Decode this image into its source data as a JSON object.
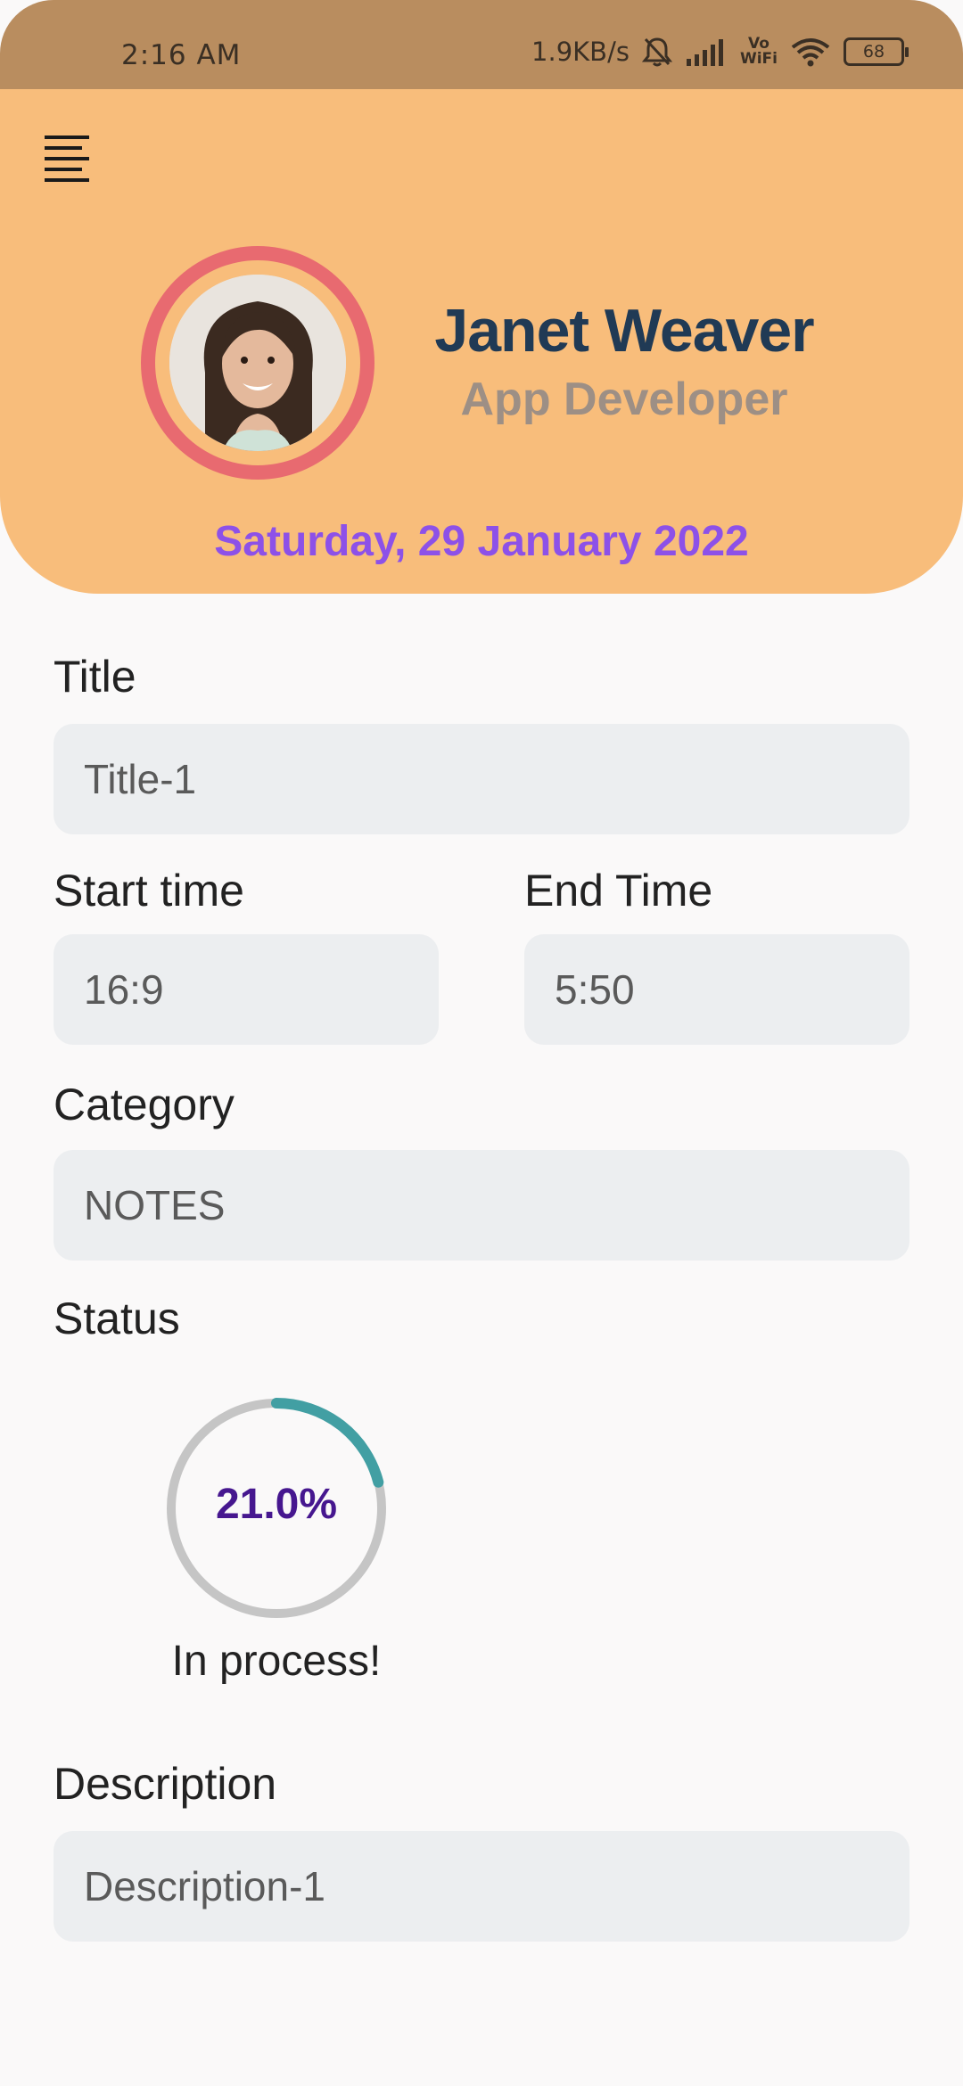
{
  "status_bar": {
    "time": "2:16 AM",
    "network_speed": "1.9KB/s",
    "vowifi_top": "Vo",
    "vowifi_bottom": "WiFi",
    "battery": "68",
    "icons": [
      "mute-bell-icon",
      "signal-bars-icon",
      "vowifi-icon",
      "wifi-icon",
      "battery-icon"
    ]
  },
  "header": {
    "menu_icon": "menu-icon",
    "user_name": "Janet Weaver",
    "user_role": "App Developer",
    "date": "Saturday, 29 January 2022",
    "colors": {
      "header_bg": "#f8bd7b",
      "status_bar_bg": "#b98d5f",
      "avatar_ring": "#e86a70",
      "name": "#203a55",
      "role": "#9d8f85",
      "date": "#8d51e8"
    }
  },
  "form": {
    "title_label": "Title",
    "title_value": "Title-1",
    "start_time_label": "Start time",
    "start_time_value": "16:9",
    "end_time_label": "End Time",
    "end_time_value": "5:50",
    "category_label": "Category",
    "category_value": "NOTES",
    "status_label": "Status",
    "status_percent_text": "21.0%",
    "status_progress": 0.21,
    "status_text": "In process!",
    "description_label": "Description",
    "description_value": "Description-1",
    "colors": {
      "field_bg": "#eceef0",
      "progress_track": "#c5c5c5",
      "progress_fill": "#429fa3",
      "percent_text": "#46178f"
    }
  }
}
